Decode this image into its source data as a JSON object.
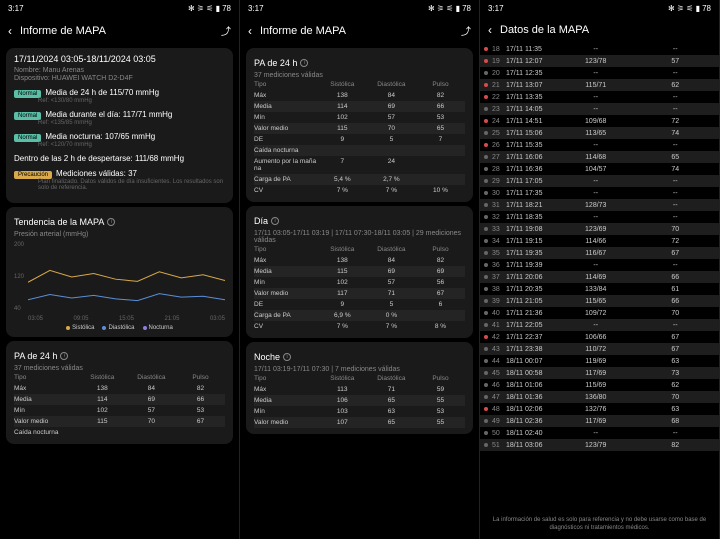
{
  "status": {
    "time": "3:17",
    "battery": "78"
  },
  "pane1": {
    "title": "Informe de MAPA",
    "range": "17/11/2024 03:05-18/11/2024 03:05",
    "name_lbl": "Nombre:",
    "name": "Manu Arenas",
    "dev_lbl": "Dispositivo:",
    "dev": "HUAWEI WATCH D2-D4F",
    "metrics": [
      {
        "tag": "Normal",
        "cls": "n",
        "text": "Media de 24 h de 115/70 mmHg",
        "ref": "Ref: <130/80 mmHg"
      },
      {
        "tag": "Normal",
        "cls": "n",
        "text": "Media durante el día: 117/71 mmHg",
        "ref": "Ref: <135/85 mmHg"
      },
      {
        "tag": "Normal",
        "cls": "n",
        "text": "Media nocturna: 107/65 mmHg",
        "ref": "Ref: <120/70 mmHg"
      },
      {
        "tag": "",
        "cls": "",
        "text": "Dentro de las 2 h de despertarse: 111/68 mmHg",
        "ref": ""
      },
      {
        "tag": "Precaución",
        "cls": "w",
        "text": "Mediciones válidas: 37",
        "ref": "Plan finalizado. Datos válidos de día insuficientes. Los resultados son solo de referencia."
      }
    ],
    "trend_title": "Tendencia de la MAPA",
    "ylabel": "Presión arterial (mmHg)",
    "chart_data": {
      "type": "line",
      "ylim": [
        40,
        200
      ],
      "x": [
        "03:05",
        "09:05",
        "15:05",
        "21:05",
        "03:05"
      ],
      "series": [
        {
          "name": "Sistólica",
          "color": "#d9a94a",
          "values": [
            108,
            135,
            120,
            128,
            115,
            110,
            132,
            118,
            125,
            112
          ]
        },
        {
          "name": "Diastólica",
          "color": "#5b8fd9",
          "values": [
            68,
            80,
            72,
            78,
            70,
            66,
            82,
            74,
            76,
            68
          ]
        },
        {
          "name": "Nocturna",
          "color": "#8a7fd9",
          "values": []
        }
      ]
    },
    "pa24_title": "PA de 24 h",
    "pa24_sub": "37 mediciones válidas",
    "headers": [
      "Tipo",
      "Sistólica",
      "Diastólica",
      "Pulso"
    ],
    "rows": [
      [
        "Máx",
        "138",
        "84",
        "82"
      ],
      [
        "Media",
        "114",
        "69",
        "66"
      ],
      [
        "Mín",
        "102",
        "57",
        "53"
      ],
      [
        "Valor medio",
        "115",
        "70",
        "67"
      ],
      [
        "Caída nocturna",
        "",
        "",
        ""
      ]
    ]
  },
  "pane2": {
    "title": "Informe de MAPA",
    "sec1": "PA de 24 h",
    "sec1_sub": "37 mediciones válidas",
    "headers": [
      "Tipo",
      "Sistólica",
      "Diastólica",
      "Pulso"
    ],
    "rows1": [
      [
        "Máx",
        "138",
        "84",
        "82"
      ],
      [
        "Media",
        "114",
        "69",
        "66"
      ],
      [
        "Mín",
        "102",
        "57",
        "53"
      ],
      [
        "Valor medio",
        "115",
        "70",
        "65"
      ],
      [
        "DE",
        "9",
        "5",
        "7"
      ],
      [
        "Caída nocturna",
        "",
        "",
        ""
      ],
      [
        "Aumento por la maña na",
        "7",
        "24",
        ""
      ],
      [
        "Carga de PA",
        "5,4 %",
        "2,7 %",
        ""
      ],
      [
        "CV",
        "7 %",
        "7 %",
        "10 %"
      ]
    ],
    "sec2": "Día",
    "sec2_sub": "17/11 03:05-17/11 03:19 | 17/11 07:30-18/11 03:05 | 29 mediciones válidas",
    "rows2": [
      [
        "Máx",
        "138",
        "84",
        "82"
      ],
      [
        "Media",
        "115",
        "69",
        "69"
      ],
      [
        "Mín",
        "102",
        "57",
        "56"
      ],
      [
        "Valor medio",
        "117",
        "71",
        "67"
      ],
      [
        "DE",
        "9",
        "5",
        "6"
      ],
      [
        "Carga de PA",
        "6,9 %",
        "0 %",
        ""
      ],
      [
        "CV",
        "7 %",
        "7 %",
        "8 %"
      ]
    ],
    "sec3": "Noche",
    "sec3_sub": "17/11 03:19-17/11 07:30 | 7 mediciones válidas",
    "rows3": [
      [
        "Máx",
        "113",
        "71",
        "59"
      ],
      [
        "Media",
        "106",
        "65",
        "55"
      ],
      [
        "Mín",
        "103",
        "63",
        "53"
      ],
      [
        "Valor medio",
        "107",
        "65",
        "55"
      ]
    ]
  },
  "pane3": {
    "title": "Datos de la MAPA",
    "rows": [
      {
        "f": "r",
        "n": "18",
        "t": "17/11 11:35",
        "v1": "--",
        "v2": "--"
      },
      {
        "f": "r",
        "n": "19",
        "t": "17/11 12:07",
        "v1": "123/78",
        "v2": "57"
      },
      {
        "f": "g",
        "n": "20",
        "t": "17/11 12:35",
        "v1": "--",
        "v2": "--"
      },
      {
        "f": "r",
        "n": "21",
        "t": "17/11 13:07",
        "v1": "115/71",
        "v2": "62"
      },
      {
        "f": "r",
        "n": "22",
        "t": "17/11 13:35",
        "v1": "--",
        "v2": "--"
      },
      {
        "f": "g",
        "n": "23",
        "t": "17/11 14:05",
        "v1": "--",
        "v2": "--"
      },
      {
        "f": "r",
        "n": "24",
        "t": "17/11 14:51",
        "v1": "109/68",
        "v2": "72"
      },
      {
        "f": "g",
        "n": "25",
        "t": "17/11 15:06",
        "v1": "113/65",
        "v2": "74"
      },
      {
        "f": "r",
        "n": "26",
        "t": "17/11 15:35",
        "v1": "--",
        "v2": "--"
      },
      {
        "f": "g",
        "n": "27",
        "t": "17/11 16:06",
        "v1": "114/68",
        "v2": "65"
      },
      {
        "f": "g",
        "n": "28",
        "t": "17/11 16:36",
        "v1": "104/57",
        "v2": "74"
      },
      {
        "f": "g",
        "n": "29",
        "t": "17/11 17:05",
        "v1": "--",
        "v2": "--"
      },
      {
        "f": "g",
        "n": "30",
        "t": "17/11 17:35",
        "v1": "--",
        "v2": "--"
      },
      {
        "f": "g",
        "n": "31",
        "t": "17/11 18:21",
        "v1": "128/73",
        "v2": "--"
      },
      {
        "f": "g",
        "n": "32",
        "t": "17/11 18:35",
        "v1": "--",
        "v2": "--"
      },
      {
        "f": "g",
        "n": "33",
        "t": "17/11 19:08",
        "v1": "123/69",
        "v2": "70"
      },
      {
        "f": "g",
        "n": "34",
        "t": "17/11 19:15",
        "v1": "114/66",
        "v2": "72"
      },
      {
        "f": "g",
        "n": "35",
        "t": "17/11 19:35",
        "v1": "116/67",
        "v2": "67"
      },
      {
        "f": "g",
        "n": "36",
        "t": "17/11 19:39",
        "v1": "--",
        "v2": "--"
      },
      {
        "f": "g",
        "n": "37",
        "t": "17/11 20:06",
        "v1": "114/69",
        "v2": "66"
      },
      {
        "f": "g",
        "n": "38",
        "t": "17/11 20:35",
        "v1": "133/84",
        "v2": "61"
      },
      {
        "f": "g",
        "n": "39",
        "t": "17/11 21:05",
        "v1": "115/65",
        "v2": "66"
      },
      {
        "f": "g",
        "n": "40",
        "t": "17/11 21:36",
        "v1": "109/72",
        "v2": "70"
      },
      {
        "f": "g",
        "n": "41",
        "t": "17/11 22:05",
        "v1": "--",
        "v2": "--"
      },
      {
        "f": "r",
        "n": "42",
        "t": "17/11 22:37",
        "v1": "106/66",
        "v2": "67"
      },
      {
        "f": "g",
        "n": "43",
        "t": "17/11 23:38",
        "v1": "110/72",
        "v2": "67"
      },
      {
        "f": "g",
        "n": "44",
        "t": "18/11 00:07",
        "v1": "119/69",
        "v2": "63"
      },
      {
        "f": "g",
        "n": "45",
        "t": "18/11 00:58",
        "v1": "117/69",
        "v2": "73"
      },
      {
        "f": "g",
        "n": "46",
        "t": "18/11 01:06",
        "v1": "115/69",
        "v2": "62"
      },
      {
        "f": "g",
        "n": "47",
        "t": "18/11 01:36",
        "v1": "136/80",
        "v2": "70"
      },
      {
        "f": "r",
        "n": "48",
        "t": "18/11 02:06",
        "v1": "132/76",
        "v2": "63"
      },
      {
        "f": "g",
        "n": "49",
        "t": "18/11 02:36",
        "v1": "117/69",
        "v2": "68"
      },
      {
        "f": "g",
        "n": "50",
        "t": "18/11 02:40",
        "v1": "--",
        "v2": "--"
      },
      {
        "f": "g",
        "n": "51",
        "t": "18/11 03:06",
        "v1": "123/79",
        "v2": "82"
      }
    ],
    "footer": "La información de salud es solo para referencia y no debe usarse como base de diagnósticos ni tratamientos médicos."
  }
}
